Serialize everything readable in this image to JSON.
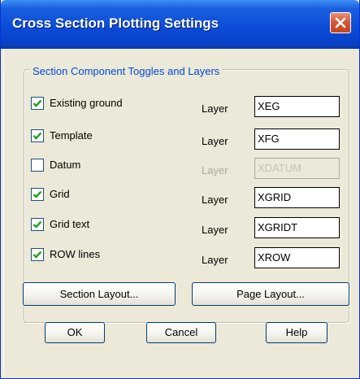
{
  "window": {
    "title": "Cross Section Plotting Settings",
    "close_icon": "close-x-icon"
  },
  "group": {
    "label": "Section Component Toggles and Layers"
  },
  "rows": [
    {
      "label": "Existing ground",
      "checked": true,
      "layer_label": "Layer",
      "layer_value": "XEG",
      "enabled": true
    },
    {
      "label": "Template",
      "checked": true,
      "layer_label": "Layer",
      "layer_value": "XFG",
      "enabled": true
    },
    {
      "label": "Datum",
      "checked": false,
      "layer_label": "Layer",
      "layer_value": "XDATUM",
      "enabled": false
    },
    {
      "label": "Grid",
      "checked": true,
      "layer_label": "Layer",
      "layer_value": "XGRID",
      "enabled": true
    },
    {
      "label": "Grid text",
      "checked": true,
      "layer_label": "Layer",
      "layer_value": "XGRIDT",
      "enabled": true
    },
    {
      "label": "ROW lines",
      "checked": true,
      "layer_label": "Layer",
      "layer_value": "XROW",
      "enabled": true
    }
  ],
  "buttons": {
    "section_layout": "Section Layout...",
    "page_layout": "Page Layout...",
    "ok": "OK",
    "cancel": "Cancel",
    "help": "Help"
  },
  "colors": {
    "titlebar": "#0a4ad6",
    "group_label": "#0046d5",
    "checkmark": "#21a121",
    "dialog_bg": "#ece9d8"
  }
}
